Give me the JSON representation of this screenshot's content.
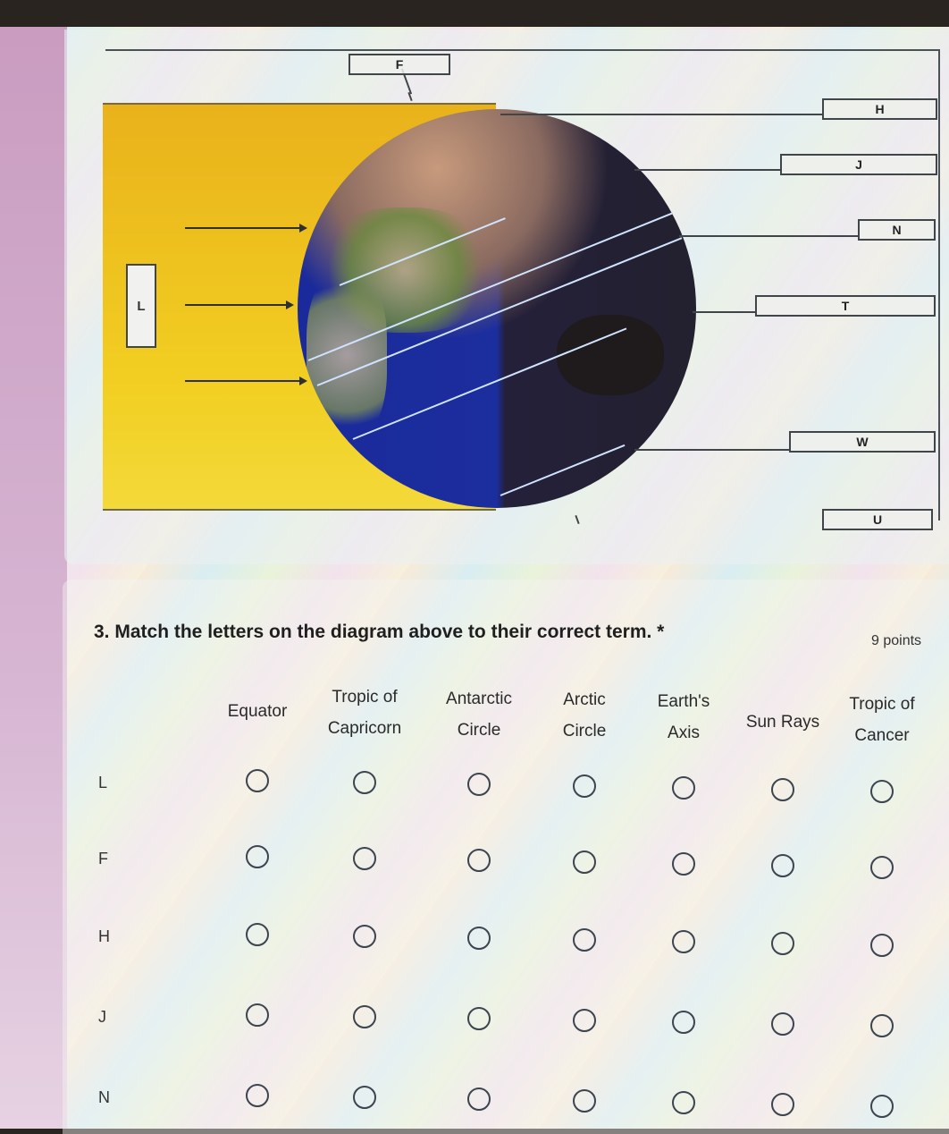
{
  "diagram": {
    "labels": {
      "F": "F",
      "H": "H",
      "J": "J",
      "N": "N",
      "T": "T",
      "W": "W",
      "U": "U",
      "L": "L"
    },
    "colors": {
      "sun_area": "#f2cf22",
      "ocean": "#1c2d9e",
      "night": "#23202f",
      "label_border": "#3f4548"
    }
  },
  "question": {
    "number_title": "3. Match the letters on the diagram above to their correct term.",
    "required_mark": "*",
    "points": "9 points",
    "columns": [
      {
        "line1": "Equator",
        "line2": ""
      },
      {
        "line1": "Tropic of",
        "line2": "Capricorn"
      },
      {
        "line1": "Antarctic",
        "line2": "Circle"
      },
      {
        "line1": "Arctic",
        "line2": "Circle"
      },
      {
        "line1": "Earth's",
        "line2": "Axis"
      },
      {
        "line1": "Sun Rays",
        "line2": ""
      },
      {
        "line1": "Tropic of",
        "line2": "Cancer"
      }
    ],
    "rows": [
      "L",
      "F",
      "H",
      "J",
      "N"
    ]
  }
}
